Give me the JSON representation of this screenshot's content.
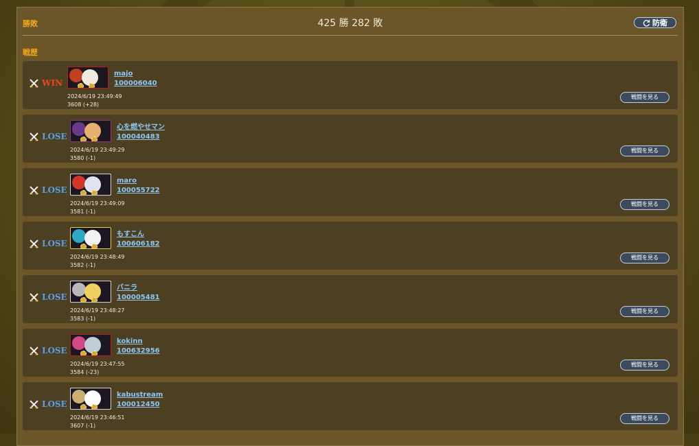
{
  "header": {
    "wl_label": "勝敗",
    "record": "425 勝 282 敗",
    "defense_label": "防衛",
    "history_label": "戦歴"
  },
  "colors": {
    "win": "#e8491e",
    "lose": "#5a9ee6",
    "gold": "#f2a81a",
    "link": "#8ec8f2"
  },
  "battles": [
    {
      "result": "WIN",
      "name": "majo",
      "id": "100006040",
      "time": "2024/6/19 23:49:49",
      "score": "3608 (+28)",
      "button": "戦闘を見る"
    },
    {
      "result": "LOSE",
      "name": "心を燃やせマン",
      "id": "100040483",
      "time": "2024/6/19 23:49:29",
      "score": "3580 (-1)",
      "button": "戦闘を見る"
    },
    {
      "result": "LOSE",
      "name": "maro",
      "id": "100055722",
      "time": "2024/6/19 23:49:09",
      "score": "3581 (-1)",
      "button": "戦闘を見る"
    },
    {
      "result": "LOSE",
      "name": "もすこん",
      "id": "100606182",
      "time": "2024/6/19 23:48:49",
      "score": "3582 (-1)",
      "button": "戦闘を見る"
    },
    {
      "result": "LOSE",
      "name": "バニラ",
      "id": "100005481",
      "time": "2024/6/19 23:48:27",
      "score": "3583 (-1)",
      "button": "戦闘を見る"
    },
    {
      "result": "LOSE",
      "name": "kokinn",
      "id": "100632956",
      "time": "2024/6/19 23:47:55",
      "score": "3584 (-23)",
      "button": "戦闘を見る"
    },
    {
      "result": "LOSE",
      "name": "kabustream",
      "id": "100012450",
      "time": "2024/6/19 23:46:51",
      "score": "3607 (-1)",
      "button": "戦闘を見る"
    }
  ]
}
